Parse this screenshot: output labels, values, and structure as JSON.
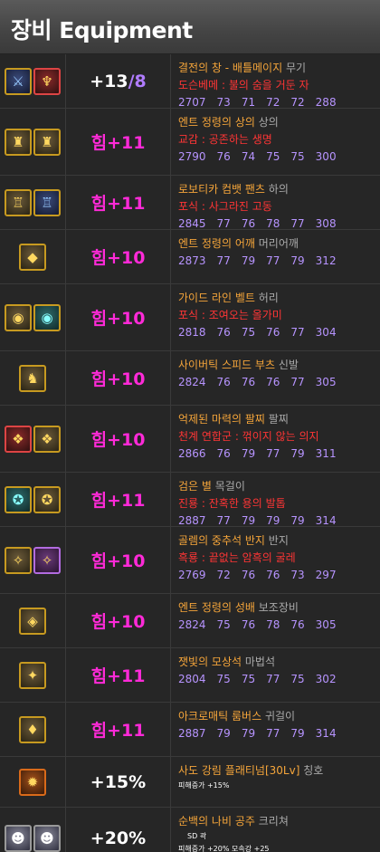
{
  "header": {
    "title": "장비 Equipment"
  },
  "rows": [
    {
      "icons": [
        {
          "name": "weapon-shield-icon",
          "glyph": "⚔",
          "cls": "blue"
        },
        {
          "name": "weapon-icon",
          "glyph": "♆",
          "cls": "red"
        }
      ],
      "stat_prefix": "+13",
      "stat_suffix": "/8",
      "item_name": "결전의 창 - 배틀메이지",
      "slot": "무기",
      "potential": "도슨베메 : 불의 숨을 거둔 자",
      "stats": [
        "2707",
        "73",
        "71",
        "72",
        "72",
        "288"
      ]
    },
    {
      "icons": [
        {
          "name": "top-armor-icon",
          "glyph": "♜",
          "cls": ""
        },
        {
          "name": "top-armor-alt-icon",
          "glyph": "♜",
          "cls": ""
        }
      ],
      "stat_prefix": "힘+11",
      "stat_suffix": "",
      "item_name": "엔트 정령의 상의",
      "slot": "상의",
      "potential": "교감 : 공존하는 생명",
      "stats": [
        "2790",
        "76",
        "74",
        "75",
        "75",
        "300"
      ]
    },
    {
      "icons": [
        {
          "name": "pants-icon",
          "glyph": "♖",
          "cls": ""
        },
        {
          "name": "pants-alt-icon",
          "glyph": "♖",
          "cls": "blue"
        }
      ],
      "stat_prefix": "힘+11",
      "stat_suffix": "",
      "item_name": "로보티카 컴뱃 팬츠",
      "slot": "하의",
      "potential": "포식 : 사그라진 고동",
      "stats": [
        "2845",
        "77",
        "76",
        "78",
        "77",
        "308"
      ]
    },
    {
      "icons": [
        {
          "name": "shoulder-icon",
          "glyph": "◆",
          "cls": ""
        }
      ],
      "stat_prefix": "힘+10",
      "stat_suffix": "",
      "item_name": "엔트 정령의 어깨",
      "slot": "머리어깨",
      "potential": "",
      "stats": [
        "2873",
        "77",
        "79",
        "77",
        "79",
        "312"
      ]
    },
    {
      "icons": [
        {
          "name": "belt-icon",
          "glyph": "◉",
          "cls": ""
        },
        {
          "name": "belt-alt-icon",
          "glyph": "◉",
          "cls": "teal"
        }
      ],
      "stat_prefix": "힘+10",
      "stat_suffix": "",
      "item_name": "가이드 라인 벨트",
      "slot": "허리",
      "potential": "포식 : 조여오는 올가미",
      "stats": [
        "2818",
        "76",
        "75",
        "76",
        "77",
        "304"
      ]
    },
    {
      "icons": [
        {
          "name": "shoes-icon",
          "glyph": "♞",
          "cls": ""
        }
      ],
      "stat_prefix": "힘+10",
      "stat_suffix": "",
      "item_name": "사이버틱 스피드 부츠",
      "slot": "신발",
      "potential": "",
      "stats": [
        "2824",
        "76",
        "76",
        "76",
        "77",
        "305"
      ]
    },
    {
      "icons": [
        {
          "name": "bracelet-icon",
          "glyph": "❖",
          "cls": "red"
        },
        {
          "name": "bracelet-alt-icon",
          "glyph": "❖",
          "cls": ""
        }
      ],
      "stat_prefix": "힘+10",
      "stat_suffix": "",
      "item_name": "억제된 마력의 팔찌",
      "slot": "팔찌",
      "potential": "천계 연합군 : 꺾이지 않는 의지",
      "stats": [
        "2866",
        "76",
        "79",
        "77",
        "79",
        "311"
      ]
    },
    {
      "icons": [
        {
          "name": "necklace-icon",
          "glyph": "✪",
          "cls": "teal"
        },
        {
          "name": "necklace-alt-icon",
          "glyph": "✪",
          "cls": ""
        }
      ],
      "stat_prefix": "힘+11",
      "stat_suffix": "",
      "item_name": "검은 별",
      "slot": "목걸이",
      "potential": "진룡 : 잔혹한 용의 발톱",
      "stats": [
        "2887",
        "77",
        "79",
        "79",
        "79",
        "314"
      ]
    },
    {
      "icons": [
        {
          "name": "ring-icon",
          "glyph": "✧",
          "cls": ""
        },
        {
          "name": "ring-alt-icon",
          "glyph": "✧",
          "cls": "purple"
        }
      ],
      "stat_prefix": "힘+10",
      "stat_suffix": "",
      "item_name": "골렘의 중추석 반지",
      "slot": "반지",
      "potential": "흑룡 : 끝없는 암흑의 굴레",
      "stats": [
        "2769",
        "72",
        "76",
        "76",
        "73",
        "297"
      ]
    },
    {
      "icons": [
        {
          "name": "sub-equipment-icon",
          "glyph": "◈",
          "cls": ""
        }
      ],
      "stat_prefix": "힘+10",
      "stat_suffix": "",
      "item_name": "엔트 정령의 성배",
      "slot": "보조장비",
      "potential": "",
      "stats": [
        "2824",
        "75",
        "76",
        "78",
        "76",
        "305"
      ]
    },
    {
      "icons": [
        {
          "name": "magic-stone-icon",
          "glyph": "✦",
          "cls": ""
        }
      ],
      "stat_prefix": "힘+11",
      "stat_suffix": "",
      "item_name": "잿빛의 모상석",
      "slot": "마법석",
      "potential": "",
      "stats": [
        "2804",
        "75",
        "75",
        "77",
        "75",
        "302"
      ]
    },
    {
      "icons": [
        {
          "name": "earring-icon",
          "glyph": "♦",
          "cls": ""
        }
      ],
      "stat_prefix": "힘+11",
      "stat_suffix": "",
      "item_name": "아크로매틱 룸버스",
      "slot": "귀걸이",
      "potential": "",
      "stats": [
        "2887",
        "79",
        "79",
        "77",
        "79",
        "314"
      ]
    }
  ],
  "title_row": {
    "icon": {
      "name": "title-badge-icon",
      "glyph": "✹",
      "cls": "orange"
    },
    "stat": "+15%",
    "item_name": "사도 강림 플래티넘[30Lv]",
    "slot": "칭호",
    "sub_text": "피해증가 +15%"
  },
  "creature_row": {
    "icons": [
      {
        "name": "creature-icon",
        "glyph": "☻",
        "cls": "char"
      },
      {
        "name": "creature-alt-icon",
        "glyph": "☻",
        "cls": "char"
      }
    ],
    "stat": "+20%",
    "item_name": "순백의 나비 공주",
    "slot": "크리쳐",
    "sub_text_1": "SD 곽",
    "sub_text_2": "피해증가 +20% 모속강 +25"
  },
  "colors": {
    "name": "#f5a53a",
    "potential": "#ff3535",
    "stats": "#b794ff",
    "stat_strength": "#ff2ad8"
  }
}
